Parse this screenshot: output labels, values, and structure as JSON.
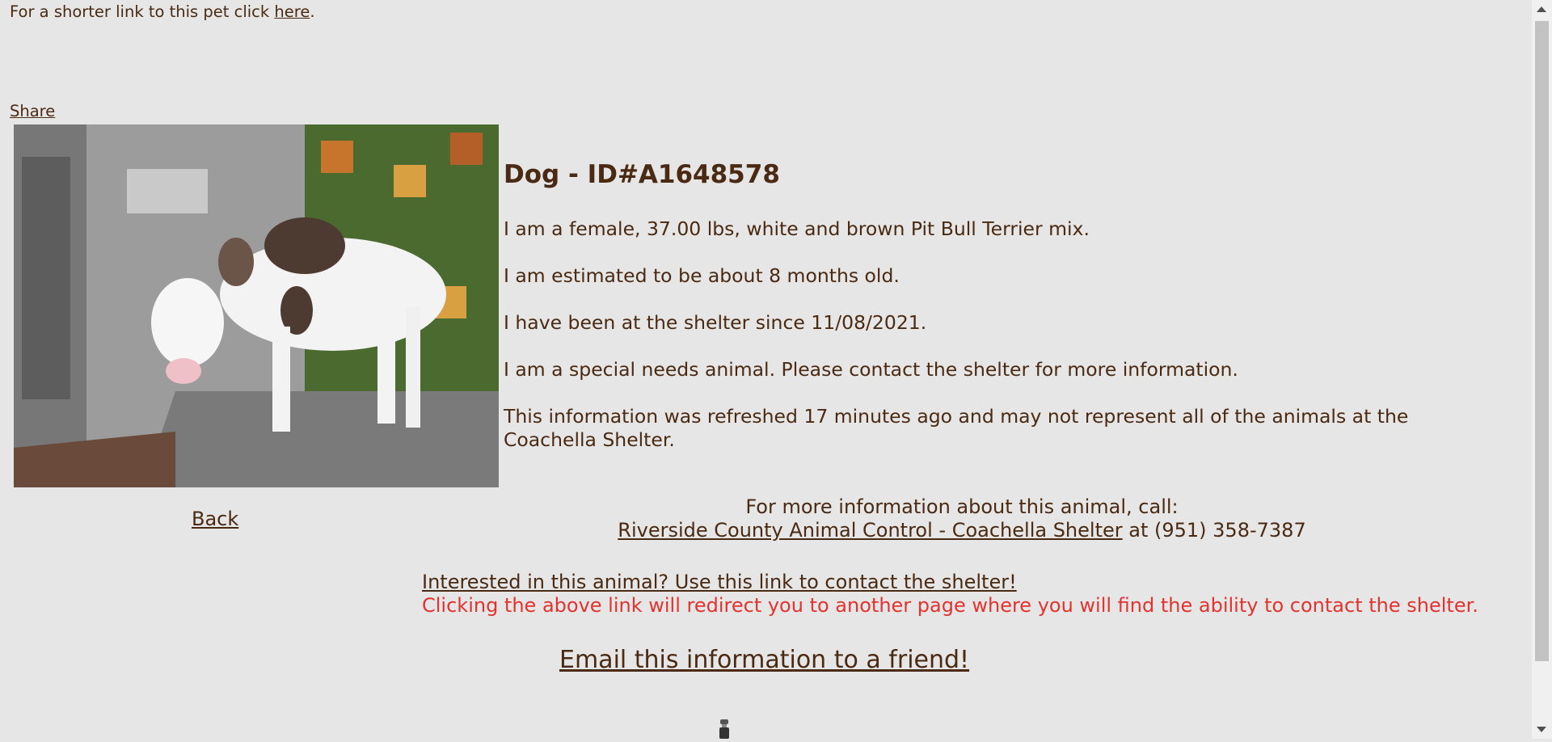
{
  "header": {
    "short_link_prefix": "For a shorter link to this pet click ",
    "short_link_label": "here",
    "short_link_suffix": ".",
    "share_label": "Share"
  },
  "animal": {
    "title": "Dog - ID#A1648578",
    "description": "I am a female, 37.00 lbs, white and brown Pit Bull Terrier mix.",
    "age": "I am estimated to be about 8 months old.",
    "shelter_since": "I have been at the shelter since 11/08/2021.",
    "special_needs": "I am a special needs animal. Please contact the shelter for more information.",
    "refresh_note": "This information was refreshed 17 minutes ago and may not represent all of the animals at the Coachella Shelter."
  },
  "nav": {
    "back_label": "Back"
  },
  "contact": {
    "call_text": "For more information about this animal, call:",
    "shelter_link": "Riverside County Animal Control - Coachella Shelter",
    "phone_text": " at (951) 358-7387",
    "interest_link": "Interested in this animal? Use this link to contact the shelter!",
    "redirect_warning": "Clicking the above link will redirect you to another page where you will find the ability to contact the shelter.",
    "email_link": "Email this information to a friend!"
  },
  "colors": {
    "background": "#e6e6e6",
    "text": "#4a2a12",
    "warning": "#e2332f"
  },
  "icons": {
    "scroll_hint": "spinner-icon"
  }
}
